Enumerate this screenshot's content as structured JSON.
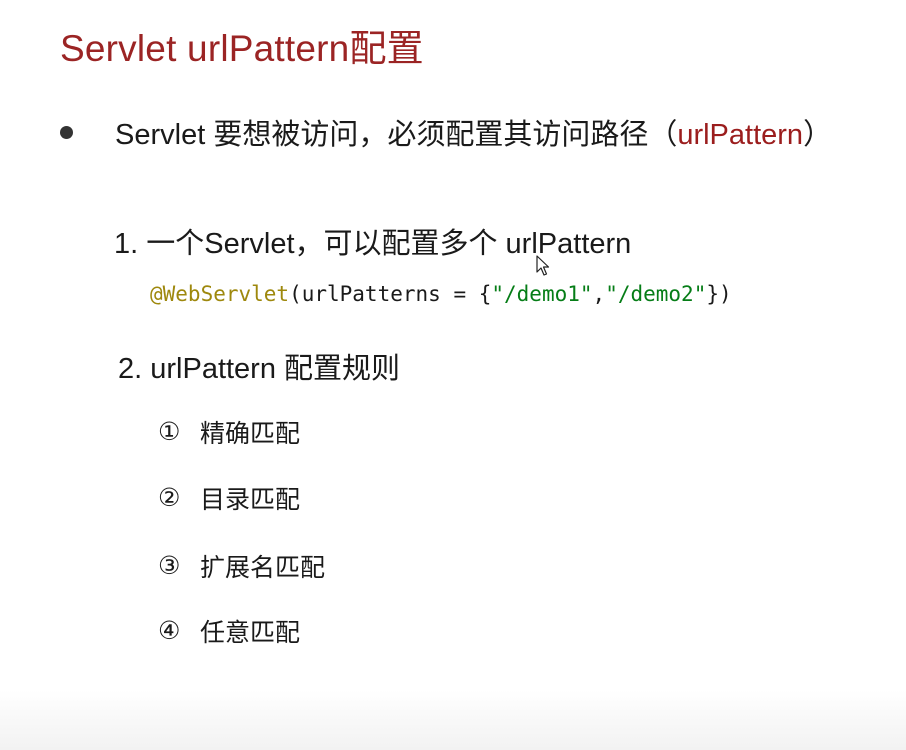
{
  "slide": {
    "title": "Servlet urlPattern配置"
  },
  "bullet": {
    "text_before": "Servlet 要想被访问，必须配置其访问路径（",
    "highlight": "urlPattern",
    "text_after": "）"
  },
  "item1": {
    "label": "1.  一个Servlet，可以配置多个 urlPattern"
  },
  "code": {
    "annotation": "@WebServlet",
    "open": "(urlPatterns = {",
    "string1": "\"/demo1\"",
    "comma": ",",
    "string2": "\"/demo2\"",
    "close": "})"
  },
  "item2": {
    "label": "2. urlPattern 配置规则"
  },
  "rules": [
    {
      "num": "①",
      "label": "精确匹配"
    },
    {
      "num": "②",
      "label": "目录匹配"
    },
    {
      "num": "③",
      "label": "扩展名匹配"
    },
    {
      "num": "④",
      "label": "任意匹配"
    }
  ],
  "colors": {
    "title": "#9b2424",
    "highlight": "#9b1d1d",
    "code_annotation": "#9e880d",
    "code_string": "#067d17"
  },
  "icons": {
    "cursor": "mouse-cursor-icon",
    "bullet": "bullet-dot-icon"
  }
}
